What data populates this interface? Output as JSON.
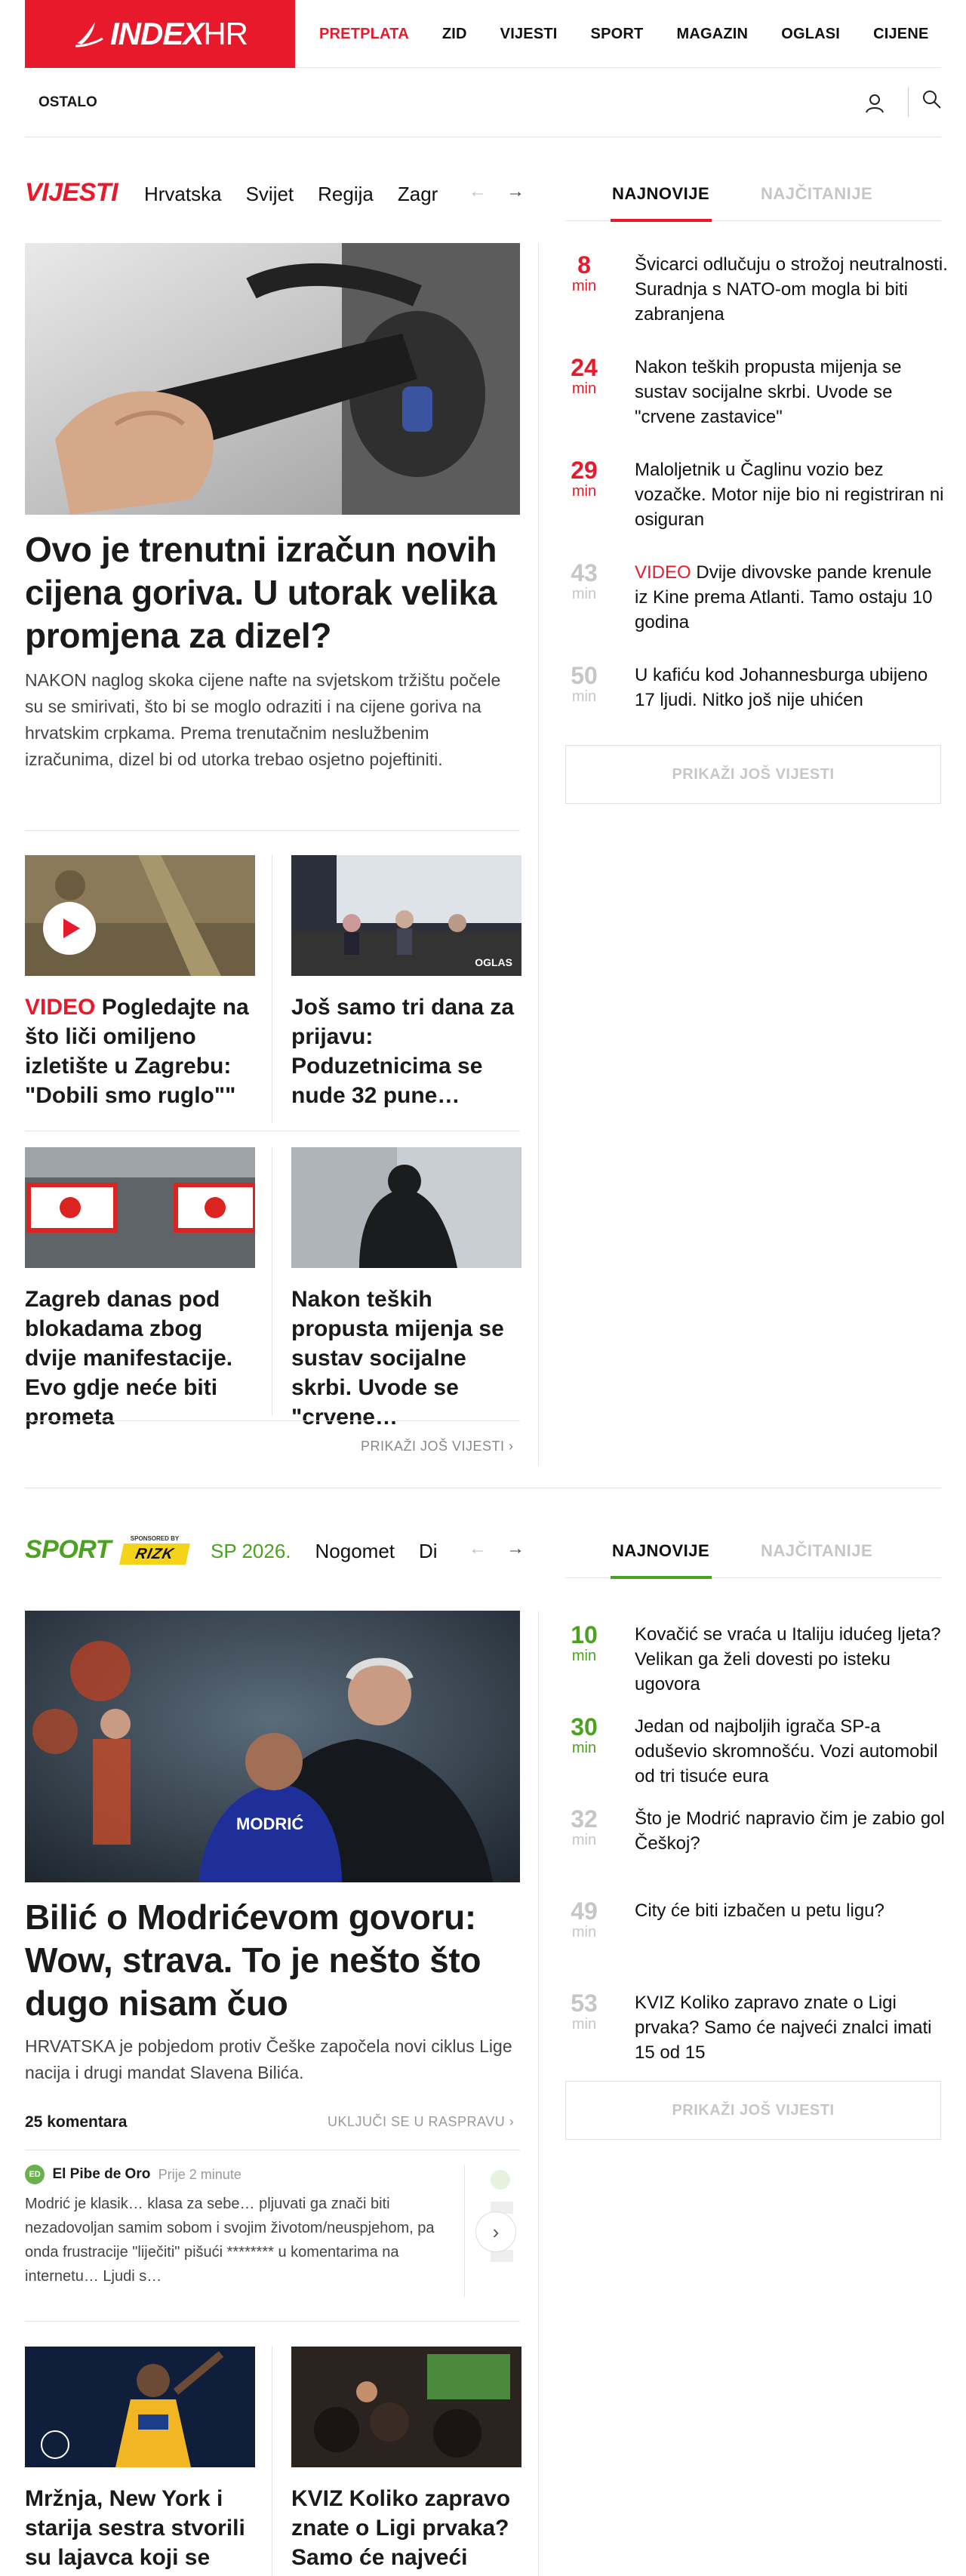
{
  "header": {
    "logo_index": "INDEX",
    "logo_hr": "HR",
    "nav": [
      {
        "label": "PRETPLATA",
        "accent": true
      },
      {
        "label": "ZID",
        "accent": false
      },
      {
        "label": "VIJESTI",
        "accent": false
      },
      {
        "label": "SPORT",
        "accent": false
      },
      {
        "label": "MAGAZIN",
        "accent": false
      },
      {
        "label": "OGLASI",
        "accent": false
      },
      {
        "label": "CIJENE",
        "accent": false
      }
    ],
    "ostalo": "OSTALO"
  },
  "colors": {
    "brand_red": "#e7192b",
    "sport_green": "#4aa31e"
  },
  "vijesti": {
    "title": "VIJESTI",
    "tabs": [
      "Hrvatska",
      "Svijet",
      "Regija",
      "Zagr"
    ],
    "right_tabs": {
      "active": "NAJNOVIJE",
      "inactive": "NAJČITANIJE"
    },
    "lead": {
      "title": "Ovo je trenutni izračun novih cijena goriva. U utorak velika promjena za dizel?",
      "text": "NAKON naglog skoka cijene nafte na svjetskom tržištu počele su se smirivati, što bi se moglo odraziti i na cijene goriva na hrvatskim crpkama. Prema trenutačnim neslužbenim izračunima, dizel bi od utorka trebao osjetno pojeftiniti."
    },
    "cards": [
      {
        "tag": "VIDEO",
        "title": " Pogledajte na što liči omiljeno izletište u Zagrebu: \"Dobili smo ruglo\"\""
      },
      {
        "tag": "",
        "title": "Još samo tri dana za prijavu: Poduzetnicima se nude 32 pune…",
        "badge": "OGLAS"
      },
      {
        "tag": "",
        "title": "Zagreb danas pod blokadama zbog dvije manifestacije. Evo gdje neće biti prometa"
      },
      {
        "tag": "",
        "title": "Nakon teških propusta mijenja se sustav socijalne skrbi. Uvode se \"crvene…"
      }
    ],
    "more_link": "PRIKAŽI JOŠ VIJESTI ›",
    "latest": [
      {
        "n": "8",
        "unit": "min",
        "tag": "",
        "text": "Švicarci odlučuju o strožoj neutralnosti. Suradnja s NATO-om mogla bi biti zabranjena",
        "fresh": true
      },
      {
        "n": "24",
        "unit": "min",
        "tag": "",
        "text": "Nakon teških propusta mijenja se sustav socijalne skrbi. Uvode se \"crvene zastavice\"",
        "fresh": true
      },
      {
        "n": "29",
        "unit": "min",
        "tag": "",
        "text": "Maloljetnik u Čaglinu vozio bez vozačke. Motor nije bio ni registriran ni osiguran",
        "fresh": true
      },
      {
        "n": "43",
        "unit": "min",
        "tag": "VIDEO",
        "text": " Dvije divovske pande krenule iz Kine prema Atlanti. Tamo ostaju 10 godina",
        "fresh": false
      },
      {
        "n": "50",
        "unit": "min",
        "tag": "",
        "text": "U kafiću kod Johannesburga ubijeno 17 ljudi. Nitko još nije uhićen",
        "fresh": false
      }
    ],
    "more_btn": "PRIKAŽI JOŠ VIJESTI"
  },
  "sport": {
    "title": "SPORT",
    "sponsored_by": "SPONSORED BY",
    "sponsor": "RIZK",
    "tabs": [
      "SP 2026.",
      "Nogomet",
      "Di"
    ],
    "right_tabs": {
      "active": "NAJNOVIJE",
      "inactive": "NAJČITANIJE"
    },
    "lead": {
      "title": "Bilić o Modrićevom govoru: Wow, strava. To je nešto što dugo nisam čuo",
      "text": "HRVATSKA je pobjedom protiv Češke započela novi ciklus Lige nacija i drugi mandat Slavena Bilića."
    },
    "comments": {
      "count": "25 komentara",
      "join": "UKLJUČI SE U RASPRAVU ›",
      "first": {
        "avatar": "ED",
        "name": "El Pibe de Oro",
        "time": "Prije 2 minute",
        "text": "Modrić je klasik… klasa za sebe… pljuvati ga znači biti nezadovoljan samim sobom i svojim životom/neuspjehom, pa onda frustracije \"liječiti\" pišući ******** u komentarima na internetu… Ljudi s…"
      }
    },
    "cards": [
      {
        "title": "Mržnja, New York i starija sestra stvorili su lajavca koji se nije"
      },
      {
        "title": "KVIZ Koliko zapravo znate o Ligi prvaka? Samo će najveći"
      }
    ],
    "latest": [
      {
        "n": "10",
        "unit": "min",
        "text": "Kovačić se vraća u Italiju idućeg ljeta? Velikan ga želi dovesti po isteku ugovora",
        "fresh": true
      },
      {
        "n": "30",
        "unit": "min",
        "text": "Jedan od najboljih igrača SP-a oduševio skromnošću. Vozi automobil od tri tisuće eura",
        "fresh": true
      },
      {
        "n": "32",
        "unit": "min",
        "text": "Što je Modrić napravio čim je zabio gol Češkoj?",
        "fresh": false
      },
      {
        "n": "49",
        "unit": "min",
        "text": "City će biti izbačen u petu ligu?",
        "fresh": false
      },
      {
        "n": "53",
        "unit": "min",
        "text": "KVIZ Koliko zapravo znate o Ligi prvaka? Samo će najveći znalci imati 15 od 15",
        "fresh": false
      }
    ],
    "more_btn": "PRIKAŽI JOŠ VIJESTI"
  }
}
